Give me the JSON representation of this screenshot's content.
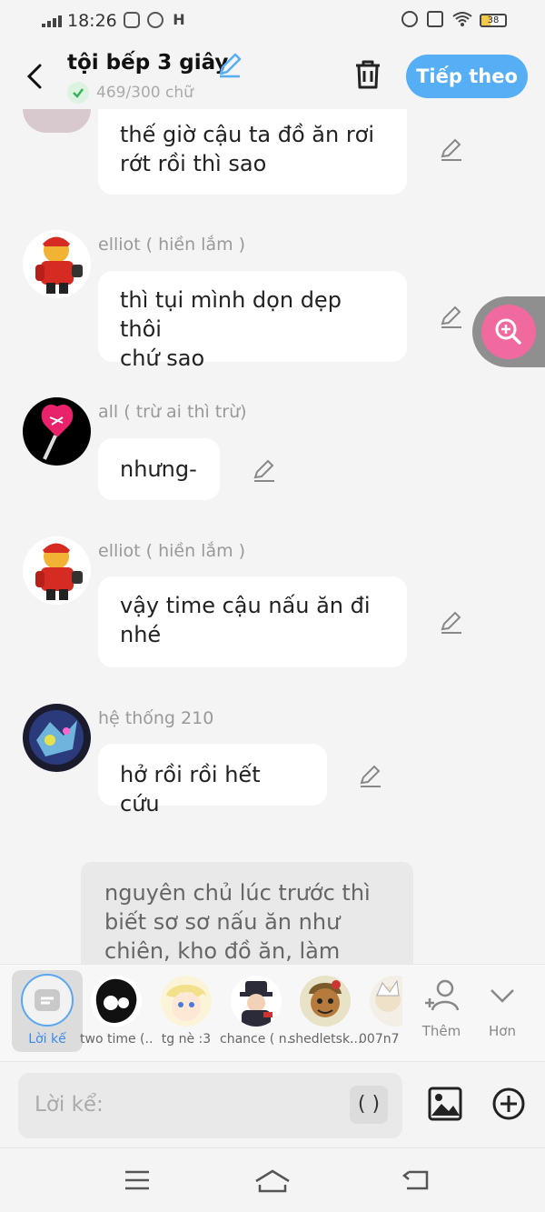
{
  "status_bar": {
    "time": "18:26",
    "battery": "38"
  },
  "header": {
    "title": "tội bếp 3 giây",
    "count": "469/300 chữ",
    "next_label": "Tiếp theo"
  },
  "top_partial_message": {
    "text_lines": [
      "thế giờ cậu ta đồ ăn rơi",
      "rớt rồi thì sao"
    ]
  },
  "messages": [
    {
      "name": "elliot ( hiền lắm )",
      "lines": [
        "thì tụi mình dọn dẹp thôi",
        "chứ sao"
      ]
    },
    {
      "name": "all ( trừ ai thì trừ)",
      "lines": [
        "nhưng-"
      ]
    },
    {
      "name": "elliot ( hiền lắm )",
      "lines": [
        "vậy time cậu nấu ăn đi",
        "nhé"
      ]
    },
    {
      "name": "hệ thống 210",
      "lines": [
        "hở rồi rồi hết cứu"
      ]
    }
  ],
  "narration": {
    "lines": [
      "nguyên chủ lúc trước thì",
      "biết sơ sơ nấu ăn như",
      "chiên, kho đồ ăn, làm"
    ]
  },
  "characters": [
    {
      "label": "Lời kể"
    },
    {
      "label": "two time (..."
    },
    {
      "label": "tg nè :3"
    },
    {
      "label": "chance ( n..."
    },
    {
      "label": "shedletsk..."
    },
    {
      "label": "007n7"
    }
  ],
  "strip_actions": {
    "add_label": "Thêm",
    "more_label": "Hơn"
  },
  "input": {
    "placeholder": "Lời kể:",
    "paren_label": "( )"
  },
  "colors": {
    "accent": "#56aef5",
    "zoom": "#f06aa0"
  }
}
